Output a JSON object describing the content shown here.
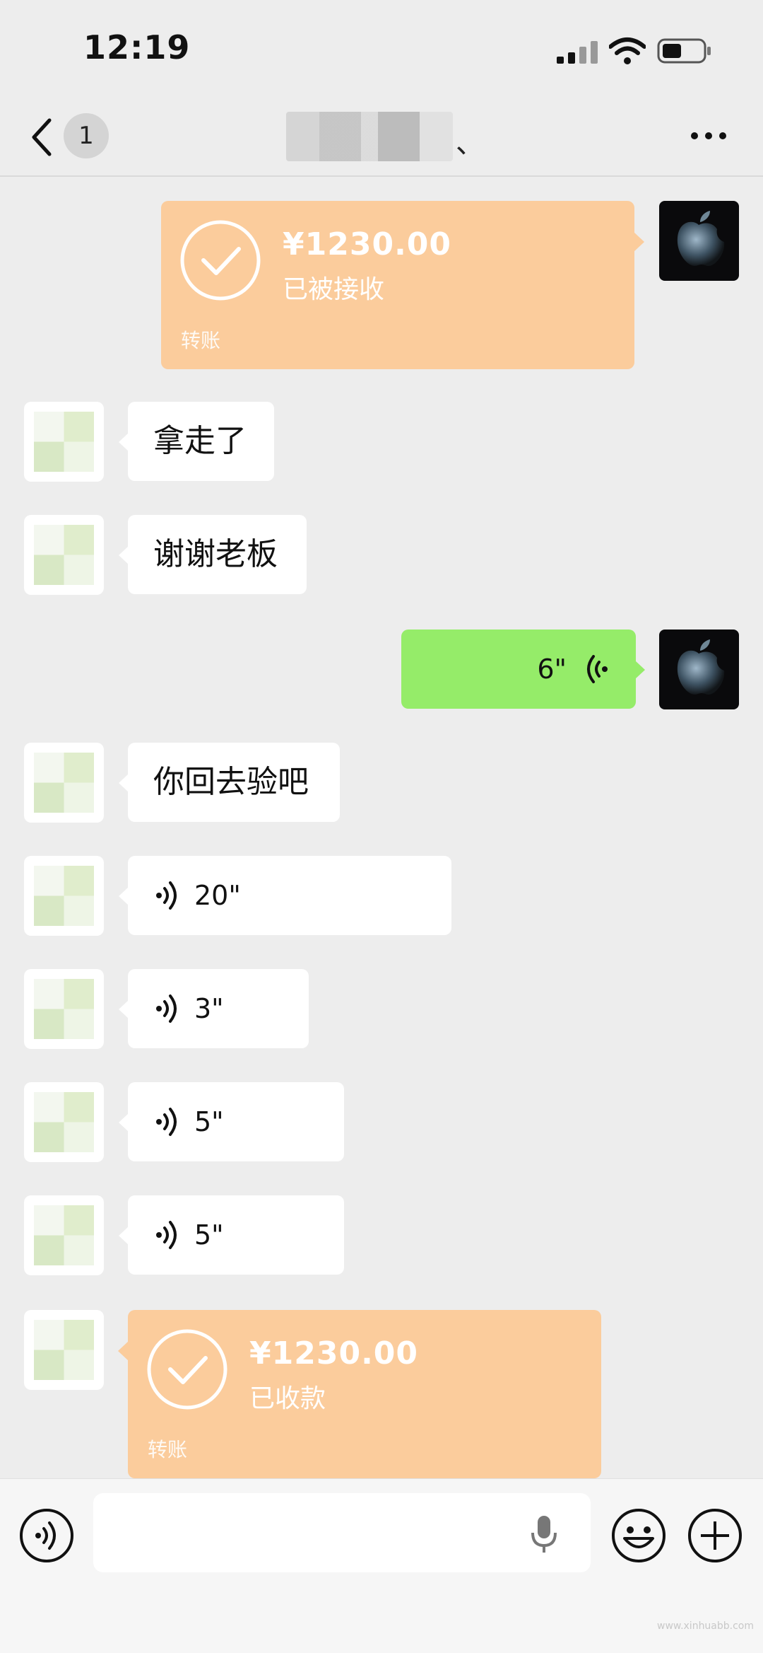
{
  "status_bar": {
    "time": "12:19"
  },
  "nav": {
    "unread_count": "1",
    "title_suffix": "、"
  },
  "messages": [
    {
      "type": "transfer",
      "from": "me",
      "amount": "¥1230.00",
      "status": "已被接收",
      "kind": "转账"
    },
    {
      "type": "text",
      "from": "other",
      "text": "拿走了"
    },
    {
      "type": "text",
      "from": "other",
      "text": "谢谢老板"
    },
    {
      "type": "voice",
      "from": "me",
      "duration": "6\""
    },
    {
      "type": "text",
      "from": "other",
      "text": "你回去验吧"
    },
    {
      "type": "voice",
      "from": "other",
      "duration": "20\""
    },
    {
      "type": "voice",
      "from": "other",
      "duration": "3\""
    },
    {
      "type": "voice",
      "from": "other",
      "duration": "5\""
    },
    {
      "type": "voice",
      "from": "other",
      "duration": "5\""
    },
    {
      "type": "transfer",
      "from": "other",
      "amount": "¥1230.00",
      "status": "已收款",
      "kind": "转账"
    }
  ],
  "input_bar": {
    "placeholder": ""
  },
  "icons": {
    "back": "chevron-left-icon",
    "more": "ellipsis-icon",
    "voice_toggle": "voice-icon",
    "mic": "microphone-icon",
    "emoji": "emoji-icon",
    "plus": "plus-icon"
  },
  "colors": {
    "background": "#ededed",
    "my_bubble": "#95ec69",
    "other_bubble": "#ffffff",
    "transfer": "#fbcc9c"
  },
  "watermark": "www.xinhuabb.com"
}
